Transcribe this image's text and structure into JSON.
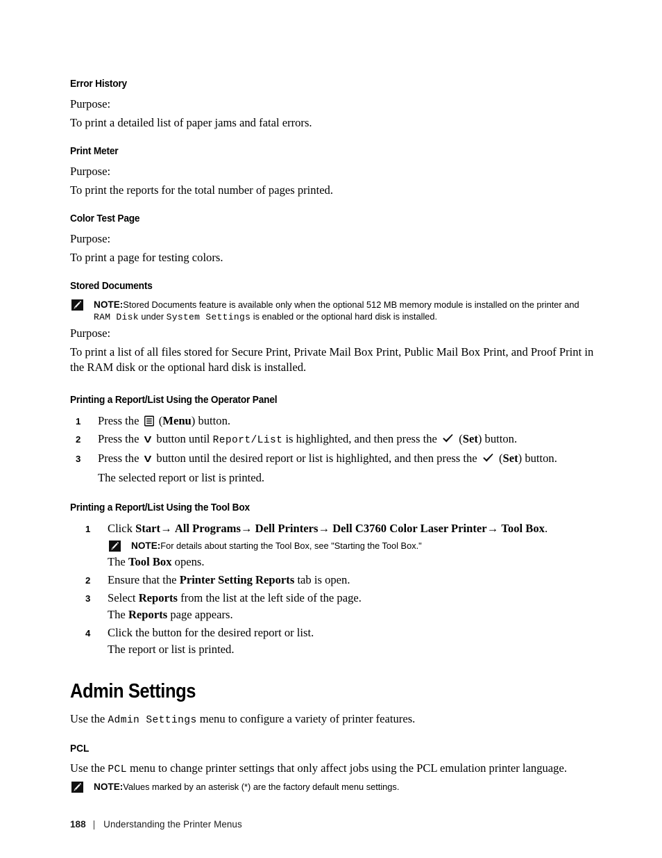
{
  "document": {
    "footer": {
      "page_number": "188",
      "separator": "|",
      "title": "Understanding the Printer Menus"
    }
  },
  "sections": {
    "error_history": {
      "heading": "Error History",
      "purpose_label": "Purpose:",
      "purpose_text": "To print a detailed list of paper jams and fatal errors."
    },
    "print_meter": {
      "heading": "Print Meter",
      "purpose_label": "Purpose:",
      "purpose_text": "To print the reports for the total number of pages printed."
    },
    "color_test_page": {
      "heading": "Color Test Page",
      "purpose_label": "Purpose:",
      "purpose_text": "To print a page for testing colors."
    },
    "stored_documents": {
      "heading": "Stored Documents",
      "note": {
        "label": "NOTE:",
        "part1": "Stored Documents feature is available only when the optional 512 MB memory module is installed on the printer and ",
        "mono1": "RAM Disk",
        "part2": " under ",
        "mono2": "System Settings",
        "part3": " is enabled or the optional hard disk is installed."
      },
      "purpose_label": "Purpose:",
      "purpose_text": "To print a list of all files stored for Secure Print, Private Mail Box Print, Public Mail Box Print, and Proof Print in the RAM disk or the optional hard disk is installed."
    },
    "operator_panel": {
      "heading": "Printing a Report/List Using the Operator Panel",
      "steps": [
        {
          "num": "1",
          "pre": "Press the ",
          "icon": "menu-icon",
          "mid": " (",
          "bold": "Menu",
          "post": ") button."
        },
        {
          "num": "2",
          "pre": "Press the ",
          "icon": "chevron-down-icon",
          "mid": " button until ",
          "mono": "Report/List",
          "mid2": " is highlighted, and then press the ",
          "icon2": "check-icon",
          "mid3": " (",
          "bold": "Set",
          "post": ") button."
        },
        {
          "num": "3",
          "pre": "Press the ",
          "icon": "chevron-down-icon",
          "mid": " button until the desired report or list is highlighted, and then press the ",
          "icon2": "check-icon",
          "mid3": " (",
          "bold": "Set",
          "post": ") button.",
          "sub": "The selected report or list is printed."
        }
      ]
    },
    "tool_box": {
      "heading": "Printing a Report/List Using the Tool Box",
      "step1": {
        "num": "1",
        "pre": "Click ",
        "b1": "Start",
        "a1": "→",
        "s1": " ",
        "b2": "All Programs",
        "a2": "→",
        "s2": " ",
        "b3": "Dell Printers",
        "a3": "→",
        "s3": " ",
        "b4": "Dell C3760 Color Laser Printer",
        "a4": "→",
        "s4": " ",
        "b5": "Tool Box",
        "post": ".",
        "note": {
          "label": "NOTE:",
          "part1": "For details about starting the ",
          "bold": "Tool Box",
          "part2": ", see \"Starting the Tool Box.\""
        },
        "sub_pre": "The ",
        "sub_bold": "Tool Box",
        "sub_post": " opens."
      },
      "step2": {
        "num": "2",
        "pre": "Ensure that the ",
        "bold": "Printer Setting Reports",
        "post": " tab is open."
      },
      "step3": {
        "num": "3",
        "pre": "Select ",
        "bold": "Reports",
        "post": " from the list at the left side of the page.",
        "sub_pre": "The ",
        "sub_bold": "Reports",
        "sub_post": " page appears."
      },
      "step4": {
        "num": "4",
        "text": "Click the button for the desired report or list.",
        "sub": "The report or list is printed."
      }
    },
    "admin_settings": {
      "heading": "Admin Settings",
      "intro_pre": "Use the ",
      "intro_mono": "Admin Settings",
      "intro_post": " menu to configure a variety of printer features."
    },
    "pcl": {
      "heading": "PCL",
      "intro_pre": "Use the ",
      "intro_mono": "PCL",
      "intro_post": " menu to change printer settings that only affect jobs using the PCL emulation printer language.",
      "note": {
        "label": "NOTE:",
        "text": "Values marked by an asterisk (*) are the factory default menu settings."
      }
    }
  }
}
